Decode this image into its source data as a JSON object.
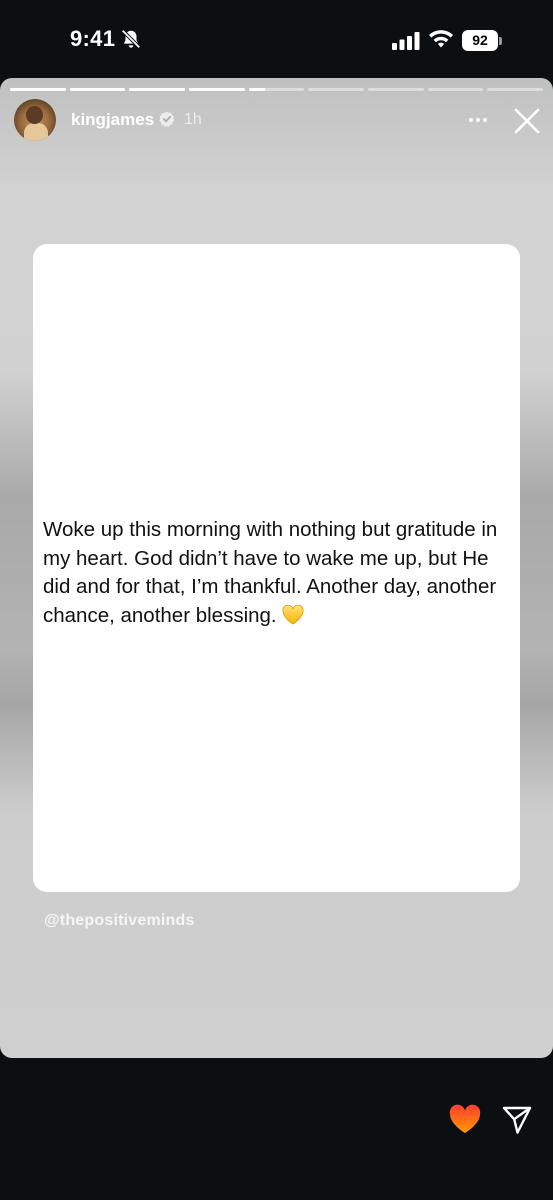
{
  "status_bar": {
    "time": "9:41",
    "battery_level": "92",
    "icons": [
      "bell-slash-icon",
      "cellular-signal-icon",
      "wifi-icon",
      "battery-icon"
    ]
  },
  "story": {
    "progress": {
      "segment_count": 9,
      "completed_segments": 4,
      "current_segment_progress": 0.3
    },
    "user": {
      "username": "kingjames",
      "verified": true,
      "time_ago": "1h"
    },
    "card": {
      "text": "Woke up this morning with nothing but gratitude in my heart. God didn’t have to wake me up, but He did and for that, I’m thankful. Another day, another chance, another blessing.",
      "emoji": "yellow-heart-icon"
    },
    "mention": "@thepositiveminds"
  },
  "footer": {
    "actions": [
      "heart-icon",
      "send-icon"
    ],
    "heart_color": "#ff4f1f"
  },
  "colors": {
    "background": "#0b0f12",
    "card": "#ffffff",
    "heart_gradient": [
      "#ffb000",
      "#ff3d2e"
    ]
  }
}
